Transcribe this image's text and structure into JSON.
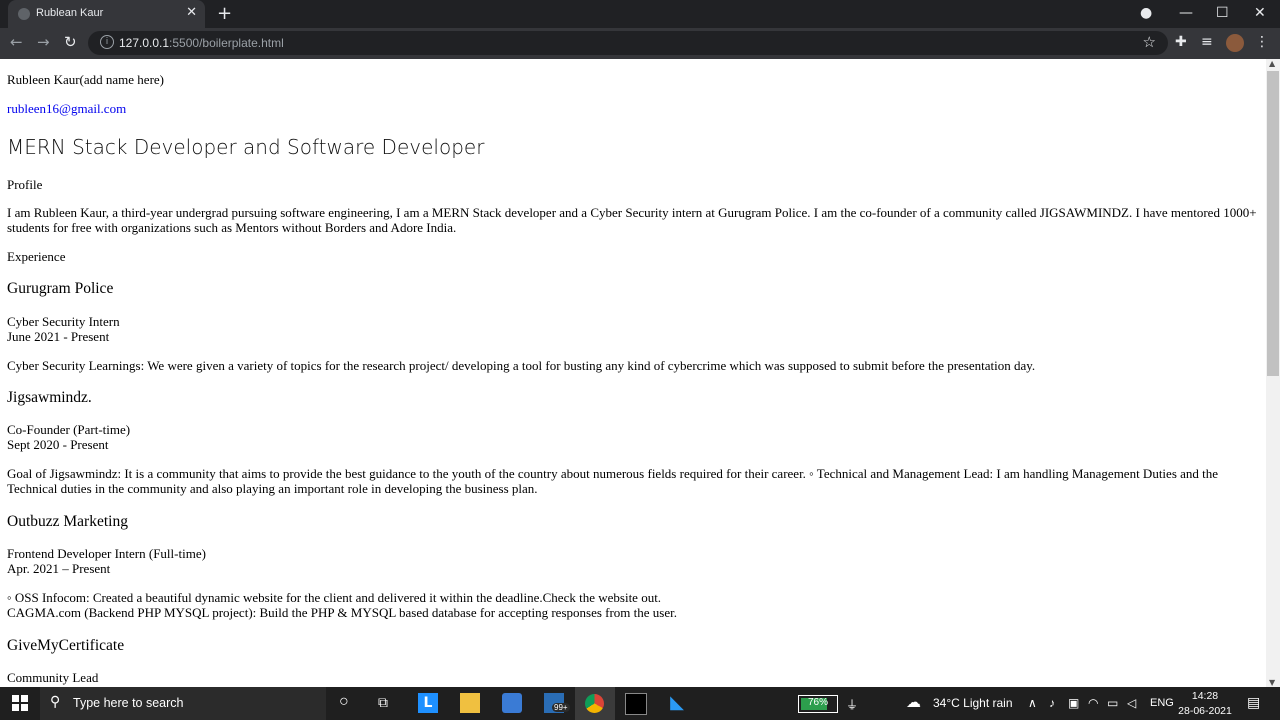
{
  "browser": {
    "tab_title": "Rublean Kaur",
    "url_host": "127.0.0.1",
    "url_rest": ":5500/boilerplate.html"
  },
  "page": {
    "name": "Rubleen Kaur(add name here)",
    "email": "rubleen16@gmail.com",
    "headline": "MERN Stack Developer and Software Developer",
    "profile_heading": "Profile",
    "profile_text": "I am Rubleen Kaur, a third-year undergrad pursuing software engineering, I am a MERN Stack developer and a Cyber Security intern at Gurugram Police. I am the co-founder of a community called JIGSAWMINDZ. I have mentored 1000+ students for free with organizations such as Mentors without Borders and Adore India.",
    "experience_heading": "Experience",
    "jobs": [
      {
        "company": "Gurugram Police",
        "role": "Cyber Security Intern",
        "dates": "June 2021 - Present",
        "desc": "Cyber Security Learnings: We were given a variety of topics for the research project/ developing a tool for busting any kind of cybercrime which was supposed to submit before the presentation day."
      },
      {
        "company": "Jigsawmindz.",
        "role": "Co-Founder (Part-time)",
        "dates": "Sept 2020 - Present",
        "desc": "Goal of Jigsawmindz: It is a community that aims to provide the best guidance to the youth of the country about numerous fields required for their career. ◦ Technical and Management Lead: I am handling Management Duties and the Technical duties in the community and also playing an important role in developing the business plan."
      },
      {
        "company": "Outbuzz Marketing",
        "role": "Frontend Developer Intern (Full-time)",
        "dates": "Apr. 2021 – Present",
        "desc": "◦ OSS Infocom: Created a beautiful dynamic website for the client and delivered it within the deadline.Check the website out.",
        "desc2": "CAGMA.com (Backend PHP MYSQL project): Build the PHP & MYSQL based database for accepting responses from the user."
      },
      {
        "company": "GiveMyCertificate",
        "role": "Community Lead"
      }
    ]
  },
  "taskbar": {
    "search_placeholder": "Type here to search",
    "battery_label": "76%",
    "battery_level": 0.76,
    "mail_badge": "99+",
    "weather": "34°C  Light rain",
    "lang": "ENG",
    "time": "14:28",
    "date": "28-06-2021"
  }
}
